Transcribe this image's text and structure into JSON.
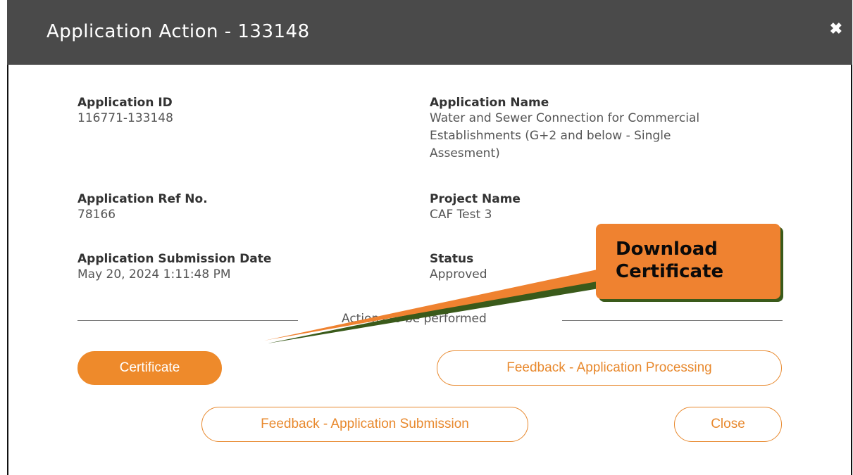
{
  "header": {
    "title": "Application Action - 133148",
    "close_icon": "close-icon"
  },
  "fields": {
    "application_id": {
      "label": "Application ID",
      "value": "116771-133148"
    },
    "application_name": {
      "label": "Application Name",
      "value_lines": [
        "Water and Sewer Connection for Commercial",
        "Establishments (G+2 and below - Single",
        "Assesment)"
      ]
    },
    "ref_no": {
      "label": "Application Ref No.",
      "value": "78166"
    },
    "project_name": {
      "label": "Project Name",
      "value": "CAF Test 3"
    },
    "submission_date": {
      "label": "Application Submission Date",
      "value": "May 20, 2024 1:11:48 PM"
    },
    "status": {
      "label": "Status",
      "value": "Approved"
    }
  },
  "actions_divider": "Actions to be performed",
  "buttons": {
    "certificate": "Certificate",
    "feedback_processing": "Feedback - Application Processing",
    "feedback_submission": "Feedback - Application Submission",
    "close": "Close"
  },
  "callout": {
    "line1": "Download",
    "line2": "Certificate"
  },
  "colors": {
    "accent": "#ee8a2b",
    "header_bg": "#4a4a4a",
    "arrow_shadow": "#3a5a1a"
  }
}
